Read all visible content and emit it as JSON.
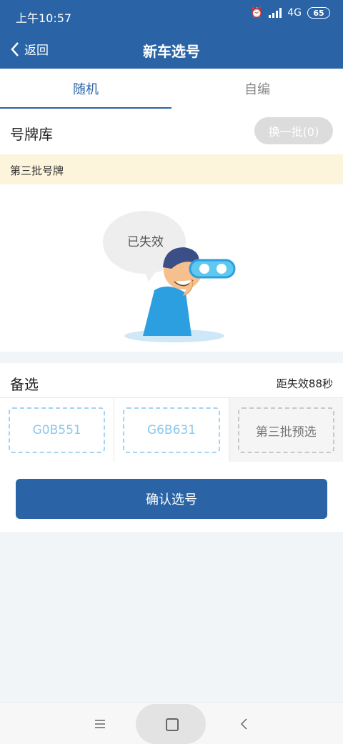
{
  "status": {
    "time": "上午10:57",
    "network": "4G",
    "battery": "65"
  },
  "header": {
    "back_label": "返回",
    "title": "新车选号"
  },
  "tabs": [
    {
      "label": "随机",
      "active": true
    },
    {
      "label": "自编",
      "active": false
    }
  ],
  "pool": {
    "title": "号牌库",
    "swap_label": "换一批(0)",
    "batch_label": "第三批号牌",
    "expired_text": "已失效"
  },
  "backup": {
    "title": "备选",
    "countdown": "距失效88秒",
    "plates": [
      "G0B551",
      "G6B631",
      "第三批预选"
    ]
  },
  "confirm_label": "确认选号",
  "colors": {
    "primary": "#2a64a6",
    "banner": "#fdf4dc",
    "plate_border": "#a5d3f0"
  }
}
